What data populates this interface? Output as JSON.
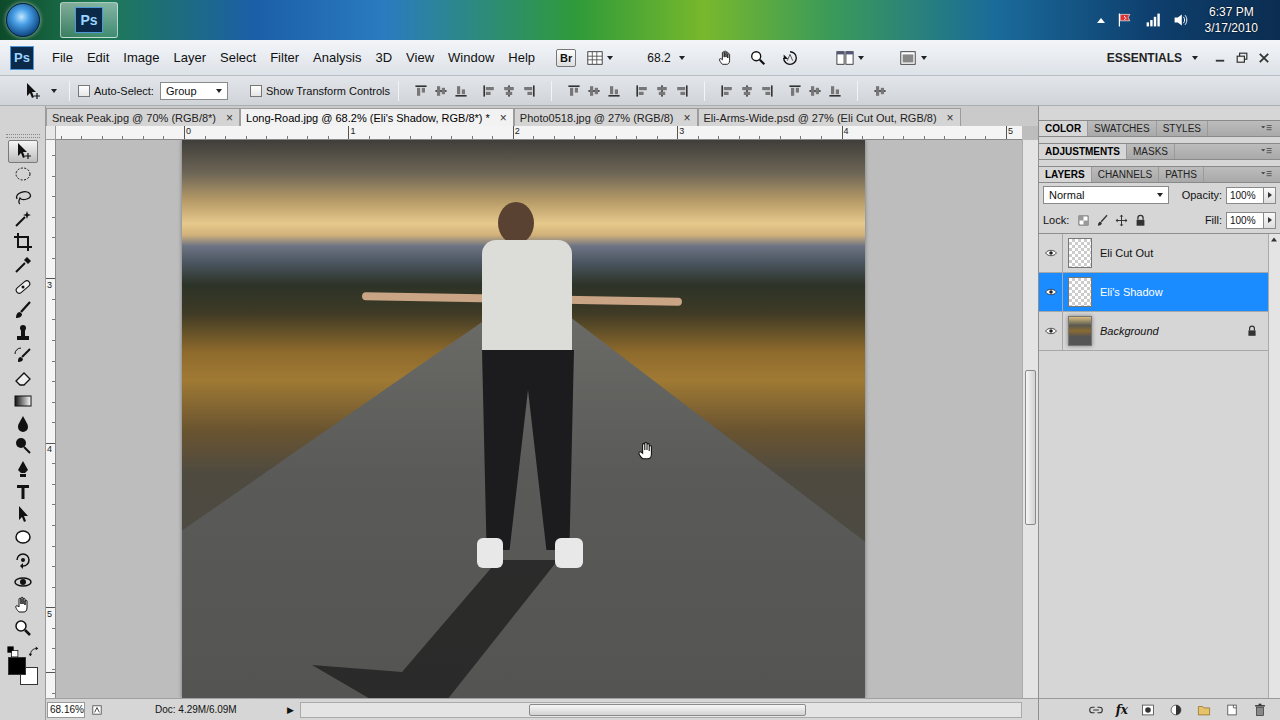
{
  "taskbar": {
    "app_button": "Ps",
    "time": "6:37 PM",
    "date": "3/17/2010"
  },
  "menubar": {
    "logo": "Ps",
    "menus": [
      "File",
      "Edit",
      "Image",
      "Layer",
      "Select",
      "Filter",
      "Analysis",
      "3D",
      "View",
      "Window",
      "Help"
    ],
    "bridge": "Br",
    "zoom": "68.2",
    "workspace": "ESSENTIALS"
  },
  "options_bar": {
    "auto_select": {
      "label": "Auto-Select:",
      "checked": false
    },
    "target": "Group",
    "transform_controls": {
      "label": "Show Transform Controls",
      "checked": false
    }
  },
  "tools": [
    {
      "selected": true
    },
    {
      "selected": false
    },
    {
      "selected": false
    },
    {
      "selected": false
    },
    {
      "selected": false
    },
    {
      "selected": false
    },
    {
      "selected": false
    },
    {
      "selected": false
    },
    {
      "selected": false
    },
    {
      "selected": false
    },
    {
      "selected": false
    },
    {
      "selected": false
    },
    {
      "selected": false
    },
    {
      "selected": false
    },
    {
      "selected": false
    },
    {
      "selected": false
    },
    {
      "selected": false
    },
    {
      "selected": false
    },
    {
      "selected": false
    },
    {
      "selected": false
    },
    {
      "selected": false
    },
    {
      "selected": false
    }
  ],
  "colors": {
    "foreground": "#000000",
    "background": "#ffffff"
  },
  "documents": [
    {
      "label": "Sneak Peak.jpg @ 70% (RGB/8*)",
      "close": "×",
      "selected": false
    },
    {
      "label": "Long-Road.jpg @ 68.2% (Eli's Shadow, RGB/8*) *",
      "close": "×",
      "selected": true
    },
    {
      "label": "Photo0518.jpg @ 27% (RGB/8)",
      "close": "×",
      "selected": false
    },
    {
      "label": "Eli-Arms-Wide.psd @ 27% (Eli Cut Out, RGB/8)",
      "close": "×",
      "selected": false
    }
  ],
  "rulers": {
    "top": [
      "0",
      "1",
      "2",
      "3",
      "4",
      "5"
    ],
    "left": [
      "3",
      "4",
      "5"
    ]
  },
  "status_bar": {
    "zoom": "68.16%",
    "doc": "Doc: 4.29M/6.09M",
    "arrow": "▶"
  },
  "panels": [
    {
      "tabs": [
        {
          "label": "COLOR",
          "selected": true
        },
        {
          "label": "SWATCHES",
          "selected": false
        },
        {
          "label": "STYLES",
          "selected": false
        }
      ]
    },
    {
      "tabs": [
        {
          "label": "ADJUSTMENTS",
          "selected": true
        },
        {
          "label": "MASKS",
          "selected": false
        }
      ]
    },
    {
      "tabs": [
        {
          "label": "LAYERS",
          "selected": true
        },
        {
          "label": "CHANNELS",
          "selected": false
        },
        {
          "label": "PATHS",
          "selected": false
        }
      ]
    }
  ],
  "layers_panel": {
    "blend_mode": "Normal",
    "opacity_label": "Opacity:",
    "opacity": "100%",
    "lock_label": "Lock:",
    "fill_label": "Fill:",
    "fill": "100%",
    "effects": "fx",
    "layers": [
      {
        "name": "Eli Cut Out",
        "visible": true,
        "selected": false,
        "locked": false,
        "kind": "transparent"
      },
      {
        "name": "Eli's Shadow",
        "visible": true,
        "selected": true,
        "locked": false,
        "kind": "transparent"
      },
      {
        "name": "Background",
        "visible": true,
        "selected": false,
        "locked": true,
        "kind": "photo"
      }
    ]
  }
}
